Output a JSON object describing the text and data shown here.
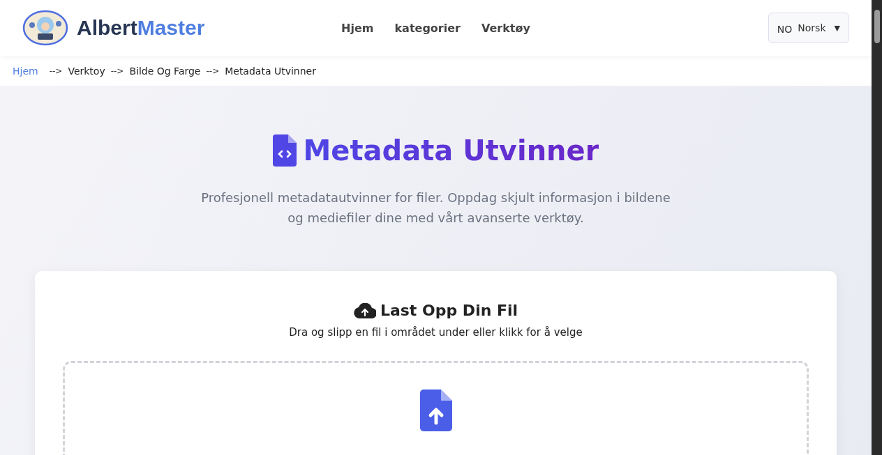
{
  "header": {
    "logo": {
      "first": "Albert",
      "second": "Master"
    },
    "nav": [
      "Hjem",
      "kategorier",
      "Verktøy"
    ],
    "language": {
      "code": "NO",
      "name": "Norsk",
      "caret": "▼"
    }
  },
  "breadcrumb": [
    {
      "label": "Hjem",
      "link": true
    },
    {
      "separator": "-->",
      "label": "Verktoy",
      "link": false
    },
    {
      "separator": "-->",
      "label": "Bilde Og Farge",
      "link": false
    },
    {
      "separator": "-->",
      "label": "Metadata Utvinner",
      "link": false
    }
  ],
  "hero": {
    "title": "Metadata Utvinner",
    "description": "Profesjonell metadatautvinner for filer. Oppdag skjult informasjon i bildene og mediefiler dine med vårt avanserte verktøy."
  },
  "upload": {
    "title": "Last Opp Din Fil",
    "instructions": "Dra og slipp en fil i området under eller klikk for å velge"
  }
}
